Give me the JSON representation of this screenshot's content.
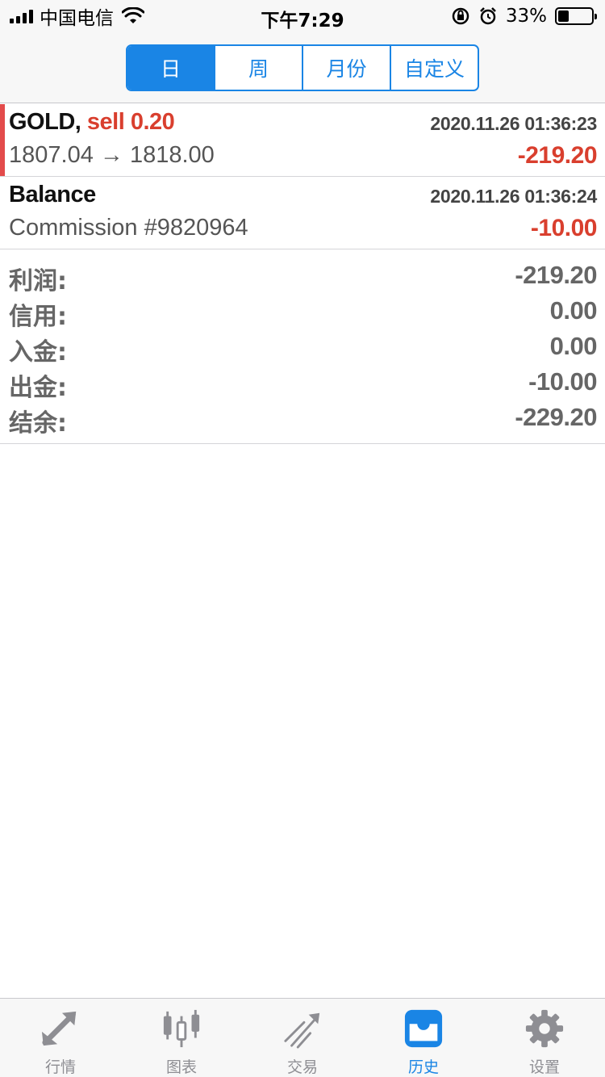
{
  "status_bar": {
    "carrier": "中国电信",
    "time": "下午7:29",
    "battery_percent": "33%",
    "battery_level": 0.33
  },
  "period_tabs": [
    {
      "label": "日",
      "active": true
    },
    {
      "label": "周",
      "active": false
    },
    {
      "label": "月份",
      "active": false
    },
    {
      "label": "自定义",
      "active": false
    }
  ],
  "deals": [
    {
      "symbol": "GOLD,",
      "side": "sell 0.20",
      "time": "2020.11.26 01:36:23",
      "prices": "1807.04 → 1818.00",
      "profit": "-219.20"
    },
    {
      "symbol": "Balance",
      "side": "",
      "time": "2020.11.26 01:36:24",
      "prices": "Commission #9820964",
      "profit": "-10.00"
    }
  ],
  "summary": [
    {
      "label": "利润:",
      "value": "-219.20"
    },
    {
      "label": "信用:",
      "value": "0.00"
    },
    {
      "label": "入金:",
      "value": "0.00"
    },
    {
      "label": "出金:",
      "value": "-10.00"
    },
    {
      "label": "结余:",
      "value": "-229.20"
    }
  ],
  "tabbar": [
    {
      "label": "行情",
      "icon": "quotes-icon",
      "active": false
    },
    {
      "label": "图表",
      "icon": "chart-icon",
      "active": false
    },
    {
      "label": "交易",
      "icon": "trade-icon",
      "active": false
    },
    {
      "label": "历史",
      "icon": "history-icon",
      "active": true
    },
    {
      "label": "设置",
      "icon": "settings-icon",
      "active": false
    }
  ],
  "colors": {
    "accent": "#1a85e5",
    "loss": "#d93f2e",
    "inactive": "#8e8e93"
  }
}
